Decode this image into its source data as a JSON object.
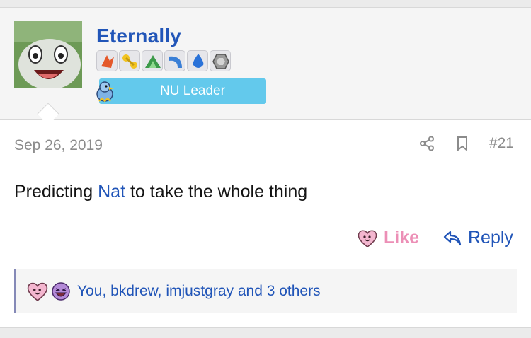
{
  "user": {
    "name": "Eternally",
    "rank": "NU Leader"
  },
  "post": {
    "date": "Sep 26, 2019",
    "number": "#21",
    "text_before": "Predicting ",
    "mention": "Nat",
    "text_after": " to take the whole thing"
  },
  "actions": {
    "like_label": "Like",
    "reply_label": "Reply"
  },
  "reactions": {
    "text": "You, bkdrew, imjustgray and 3 others"
  },
  "colors": {
    "accent": "#2155b8",
    "like": "#ec8fb6",
    "rank_pill": "#63c9ec"
  }
}
